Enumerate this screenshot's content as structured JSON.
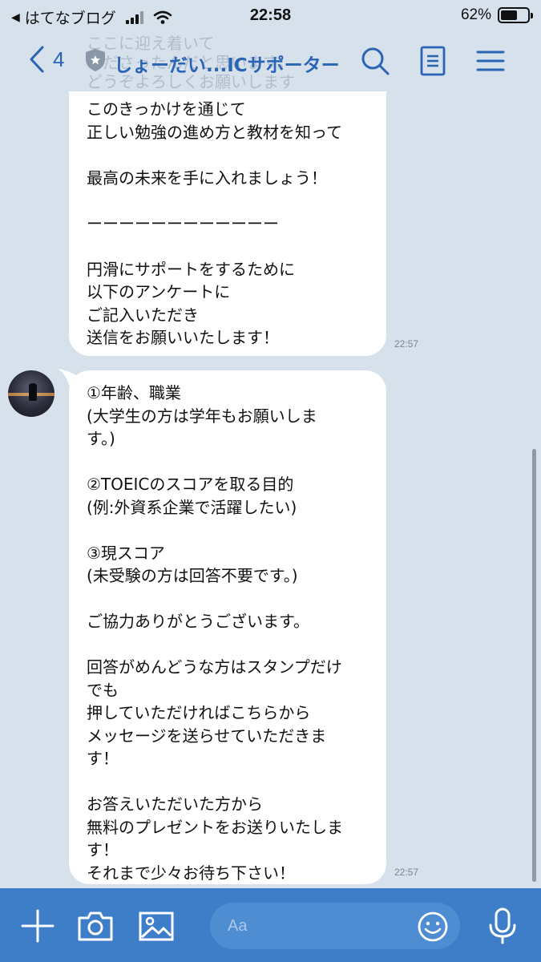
{
  "status_bar": {
    "back_app": "はてなブログ",
    "time": "22:58",
    "battery": "62%",
    "battery_level": 0.62
  },
  "header": {
    "ghost_text": "ここに迎え着いて\nくださったんだと思います。\nどうぞよろしくお願いします",
    "back_count": "4",
    "title": "しょーだい...ICサポーター"
  },
  "messages": [
    {
      "text": "このきっかけを通じて\n正しい勉強の進め方と教材を知って\n\n最高の未来を手に入れましょう！\n\nーーーーーーーーーーーー\n\n円滑にサポートをするために\n以下のアンケートに\nご記入いただき\n送信をお願いいたします！",
      "time": "22:57"
    },
    {
      "text": "①年齢、職業\n(大学生の方は学年もお願いしま\nす。)\n\n②TOEICのスコアを取る目的\n(例:外資系企業で活躍したい)\n\n③現スコア\n(未受験の方は回答不要です。)\n\nご協力ありがとうございます。\n\n回答がめんどうな方はスタンプだけ\nでも\n押していただければこちらから\nメッセージを送らせていただきま\nす！\n\nお答えいただいた方から\n無料のプレゼントをお送りいたしま\nす！\nそれまで少々お待ち下さい！",
      "time": "22:57"
    }
  ],
  "input": {
    "placeholder": "Aa"
  },
  "colors": {
    "accent": "#2a64b4",
    "chat_bg": "#d6e1ec",
    "input_bar": "#3e7ec8"
  },
  "icons": [
    "back-arrow-icon",
    "shield-star-icon",
    "search-icon",
    "notes-icon",
    "menu-icon",
    "plus-icon",
    "camera-icon",
    "image-icon",
    "emoji-icon",
    "microphone-icon"
  ]
}
